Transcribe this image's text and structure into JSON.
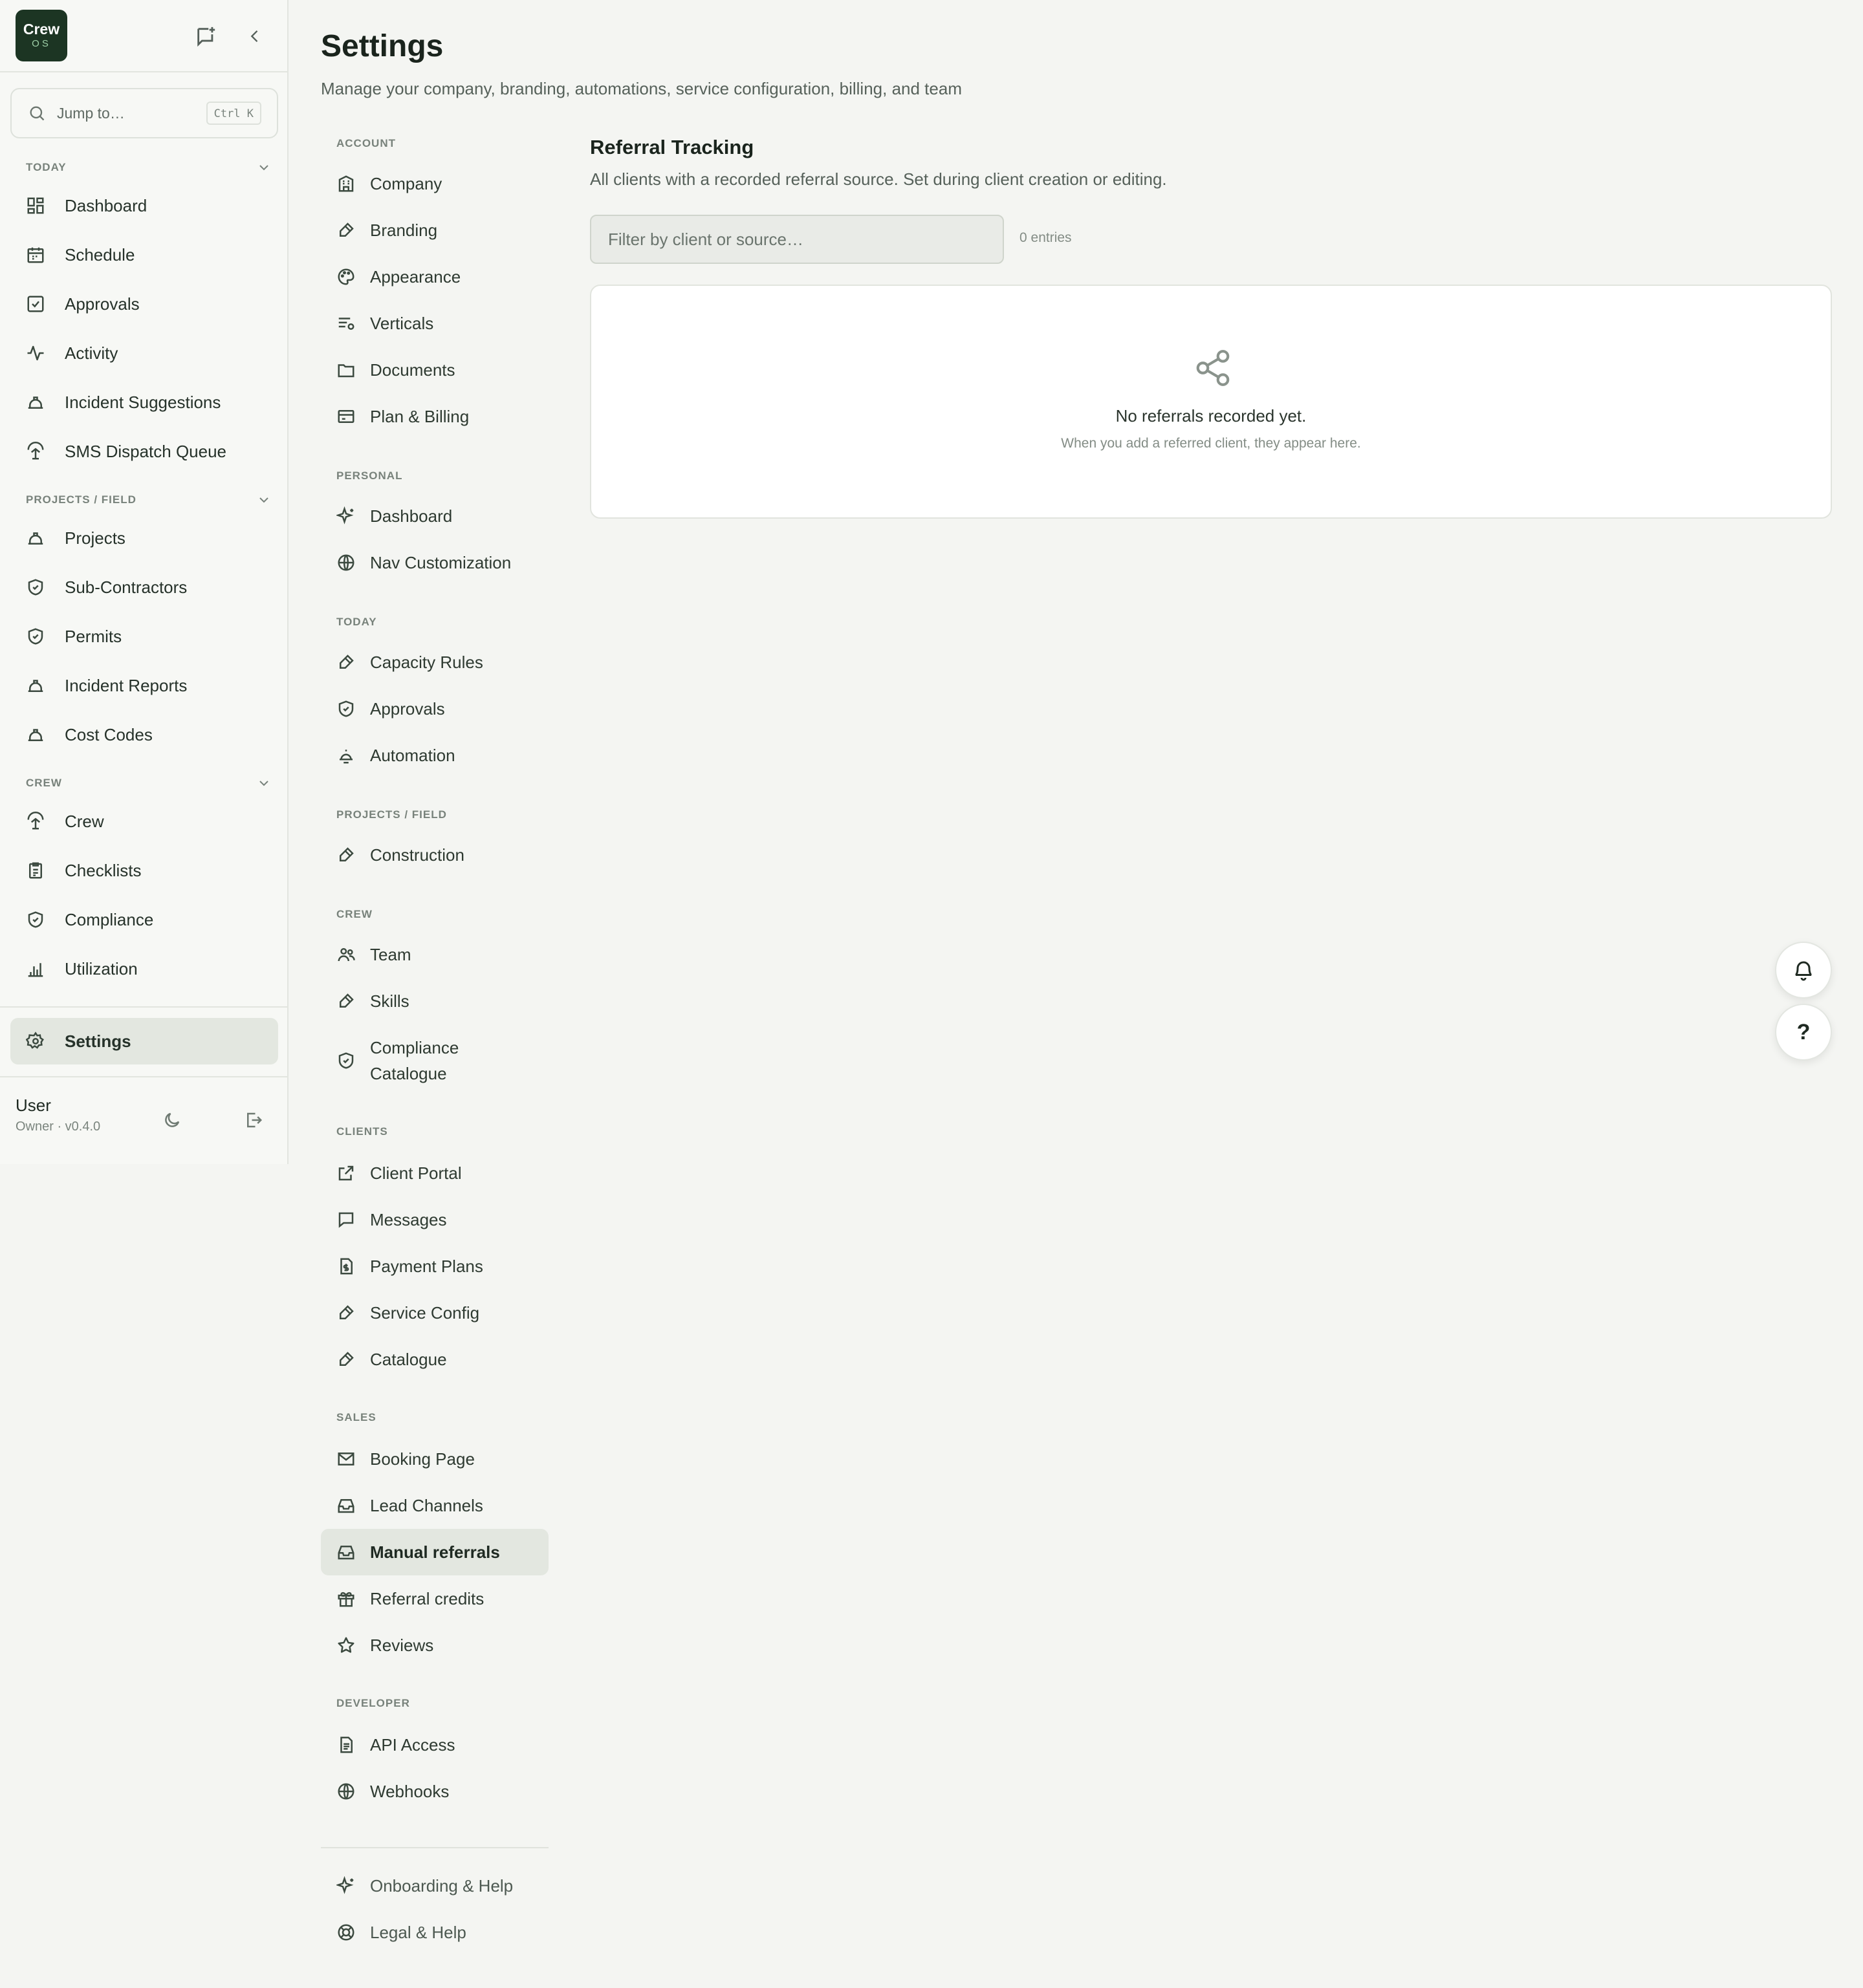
{
  "app": {
    "logo_line1": "Crew",
    "logo_line2": "OS",
    "brand_color": "#1c3523"
  },
  "sidebar": {
    "search": {
      "placeholder": "Jump to…",
      "shortcut": "Ctrl K"
    },
    "sections": [
      {
        "title": "TODAY",
        "items": [
          {
            "label": "Dashboard",
            "icon": "dashboard-icon"
          },
          {
            "label": "Schedule",
            "icon": "calendar-icon"
          },
          {
            "label": "Approvals",
            "icon": "checkbox-icon"
          },
          {
            "label": "Activity",
            "icon": "activity-icon"
          },
          {
            "label": "Incident Suggestions",
            "icon": "hardhat-icon"
          },
          {
            "label": "SMS Dispatch Queue",
            "icon": "dispatch-icon"
          }
        ]
      },
      {
        "title": "PROJECTS / FIELD",
        "items": [
          {
            "label": "Projects",
            "icon": "hardhat-icon"
          },
          {
            "label": "Sub-Contractors",
            "icon": "shield-icon"
          },
          {
            "label": "Permits",
            "icon": "shield-icon"
          },
          {
            "label": "Incident Reports",
            "icon": "hardhat-icon"
          },
          {
            "label": "Cost Codes",
            "icon": "hardhat-icon"
          }
        ]
      },
      {
        "title": "CREW",
        "items": [
          {
            "label": "Crew",
            "icon": "dispatch-icon"
          },
          {
            "label": "Checklists",
            "icon": "clipboard-icon"
          },
          {
            "label": "Compliance",
            "icon": "shield-icon"
          },
          {
            "label": "Utilization",
            "icon": "bar-chart-icon"
          }
        ]
      }
    ],
    "settings_label": "Settings",
    "user": {
      "name": "User",
      "meta": "Owner · v0.4.0"
    }
  },
  "header": {
    "title": "Settings",
    "subtitle": "Manage your company, branding, automations, service configuration, billing, and team"
  },
  "settings_nav": {
    "account": {
      "title": "ACCOUNT",
      "items": [
        "Company",
        "Branding",
        "Appearance",
        "Verticals",
        "Documents",
        "Plan & Billing"
      ]
    },
    "personal": {
      "title": "PERSONAL",
      "items": [
        "Dashboard",
        "Nav Customization"
      ]
    },
    "today": {
      "title": "TODAY",
      "items": [
        "Capacity Rules",
        "Approvals",
        "Automation"
      ]
    },
    "projects": {
      "title": "PROJECTS / FIELD",
      "items": [
        "Construction"
      ]
    },
    "crew": {
      "title": "CREW",
      "items": [
        "Team",
        "Skills",
        "Compliance",
        "Catalogue"
      ]
    },
    "clients": {
      "title": "CLIENTS",
      "items": [
        "Client Portal",
        "Messages",
        "Payment Plans",
        "Service Config",
        "Catalogue"
      ]
    },
    "sales": {
      "title": "SALES",
      "items": [
        "Booking Page",
        "Lead Channels",
        "Manual referrals",
        "Referral credits",
        "Reviews"
      ]
    },
    "developer": {
      "title": "DEVELOPER",
      "items": [
        "API Access",
        "Webhooks"
      ]
    },
    "footer": [
      "Onboarding & Help",
      "Legal & Help"
    ],
    "active": "Manual referrals"
  },
  "main": {
    "title": "Referral Tracking",
    "description": "All clients with a recorded referral source. Set during client creation or editing.",
    "filter_placeholder": "Filter by client or source…",
    "entries": "0 entries",
    "empty_title": "No referrals recorded yet.",
    "empty_subtitle": "When you add a referred client, they appear here."
  },
  "floating": {
    "help_label": "?"
  }
}
